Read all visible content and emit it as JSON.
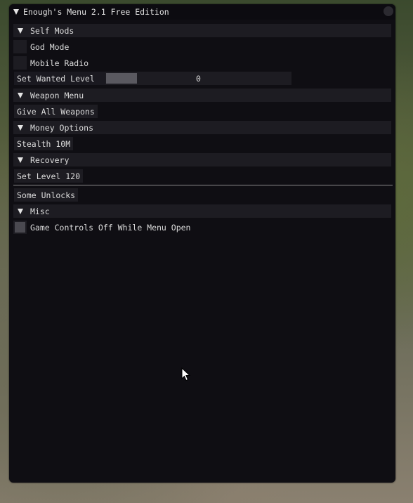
{
  "window": {
    "title": "Enough's Menu 2.1 Free Edition"
  },
  "self_mods": {
    "header": "Self Mods",
    "god_mode": "God Mode",
    "mobile_radio": "Mobile Radio",
    "wanted_label": "Set Wanted Level",
    "wanted_value": "0"
  },
  "weapon_menu": {
    "header": "Weapon Menu",
    "give_all": "Give All Weapons"
  },
  "money_options": {
    "header": "Money Options",
    "stealth": "Stealth 10M"
  },
  "recovery": {
    "header": "Recovery",
    "set_level": "Set Level 120",
    "some_unlocks": "Some Unlocks"
  },
  "misc": {
    "header": "Misc",
    "game_controls": "Game Controls Off While Menu Open"
  }
}
